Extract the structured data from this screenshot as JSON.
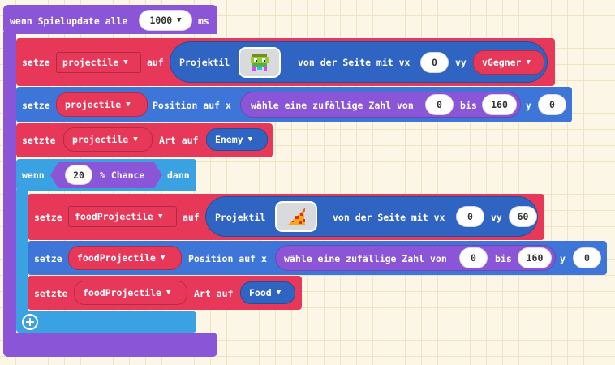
{
  "event": {
    "label": "wenn Spielupdate alle",
    "interval": "1000",
    "unit": "ms"
  },
  "set_projectile": {
    "setze": "setze",
    "var": "projectile",
    "auf": "auf",
    "projektil": "Projektil",
    "image": "enemy-sprite",
    "von": "von der Seite mit vx",
    "vx": "0",
    "vy_label": "vy",
    "vy": "vGegner"
  },
  "position_projectile": {
    "setze": "setze",
    "var": "projectile",
    "label": "Position auf x",
    "random": "wähle eine zufällige Zahl von",
    "from": "0",
    "bis": "bis",
    "to": "160",
    "y_label": "y",
    "y": "0"
  },
  "kind_projectile": {
    "setzte": "setzte",
    "var": "projectile",
    "label": "Art auf",
    "kind": "Enemy"
  },
  "if_block": {
    "wenn": "wenn",
    "chance": "20",
    "chance_label": "% Chance",
    "dann": "dann"
  },
  "set_food": {
    "setze": "setze",
    "var": "foodProjectile",
    "auf": "auf",
    "projektil": "Projektil",
    "image": "pizza-sprite",
    "von": "von der Seite mit vx",
    "vx": "0",
    "vy_label": "vy",
    "vy": "60"
  },
  "position_food": {
    "setze": "setze",
    "var": "foodProjectile",
    "label": "Position auf x",
    "random": "wähle eine zufällige Zahl von",
    "from": "0",
    "bis": "bis",
    "to": "160",
    "y_label": "y",
    "y": "0"
  },
  "kind_food": {
    "setzte": "setzte",
    "var": "foodProjectile",
    "label": "Art auf",
    "kind": "Food"
  },
  "colors": {
    "event": "#8a55d6",
    "sprites": "#e8385a",
    "position": "#3d75d8",
    "logic": "#3aa2e3",
    "math": "#8a55d6"
  }
}
